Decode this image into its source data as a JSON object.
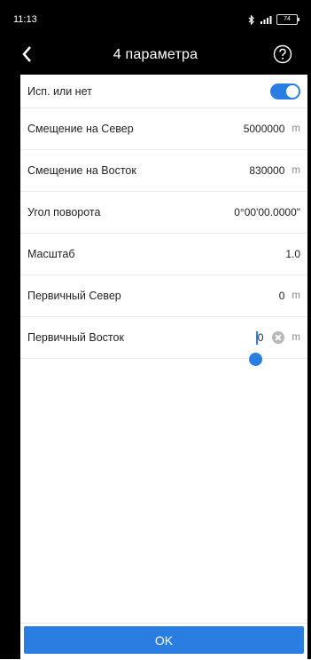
{
  "status_bar": {
    "time": "11:13",
    "icons": [
      "bluetooth-icon",
      "signal-icon"
    ],
    "battery": "74"
  },
  "header": {
    "title": "4 параметра"
  },
  "rows": [
    {
      "label": "Исп. или нет",
      "toggle_on": true
    },
    {
      "label": "Смещение на Север",
      "value": "5000000",
      "unit": "m"
    },
    {
      "label": "Смещение на Восток",
      "value": "830000",
      "unit": "m"
    },
    {
      "label": "Угол поворота",
      "value": "0°00'00.0000\""
    },
    {
      "label": "Масштаб",
      "value": "1.0"
    },
    {
      "label": "Первичный Север",
      "value": "0",
      "unit": "m"
    },
    {
      "label": "Первичный Восток",
      "value": "0",
      "unit": "m"
    }
  ],
  "footer": {
    "ok_label": "OK"
  },
  "colors": {
    "accent": "#2a7de1"
  }
}
